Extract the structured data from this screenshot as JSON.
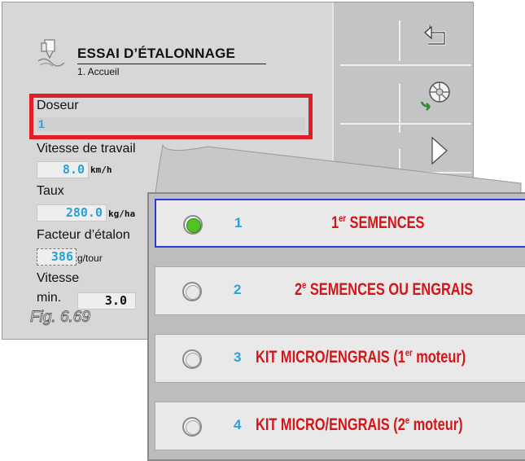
{
  "header": {
    "title": "ESSAI D’ÉTALONNAGE",
    "subtitle": "1. Accueil"
  },
  "fields": {
    "doseur": {
      "label": "Doseur",
      "value": "1"
    },
    "vitesse_travail": {
      "label": "Vitesse de travail",
      "value": "8.0",
      "unit": "km/h"
    },
    "taux": {
      "label": "Taux",
      "value": "280.0",
      "unit": "kg/ha"
    },
    "facteur": {
      "label": "Facteur d’étalon",
      "value": "386",
      "unit": "g/tour"
    },
    "vitesse_min": {
      "label_line1": "Vitesse",
      "label_line2": "min.",
      "value": "3.0"
    }
  },
  "caption": "Fig. 6.69",
  "popup": {
    "options": [
      {
        "num": "1",
        "text_pre": "1",
        "sup": "er",
        "text_post": " SEMENCES",
        "selected": true
      },
      {
        "num": "2",
        "text_pre": "2",
        "sup": "e",
        "text_post": " SEMENCES OU ENGRAIS",
        "selected": false
      },
      {
        "num": "3",
        "text_pre": "KIT MICRO/ENGRAIS (1",
        "sup": "er",
        "text_post": " moteur)",
        "selected": false
      },
      {
        "num": "4",
        "text_pre": "KIT MICRO/ENGRAIS (2",
        "sup": "e",
        "text_post": " moteur)",
        "selected": false
      }
    ]
  },
  "soft_keys": [
    "back-arrow-icon",
    "calibration-wheel-icon",
    "next-arrow-icon"
  ],
  "colors": {
    "accent_blue": "#2aa0d8",
    "highlight_red": "#e11d25",
    "option_text_red": "#d21619",
    "selected_green": "#54c127",
    "selected_border": "#2b3bd8"
  }
}
